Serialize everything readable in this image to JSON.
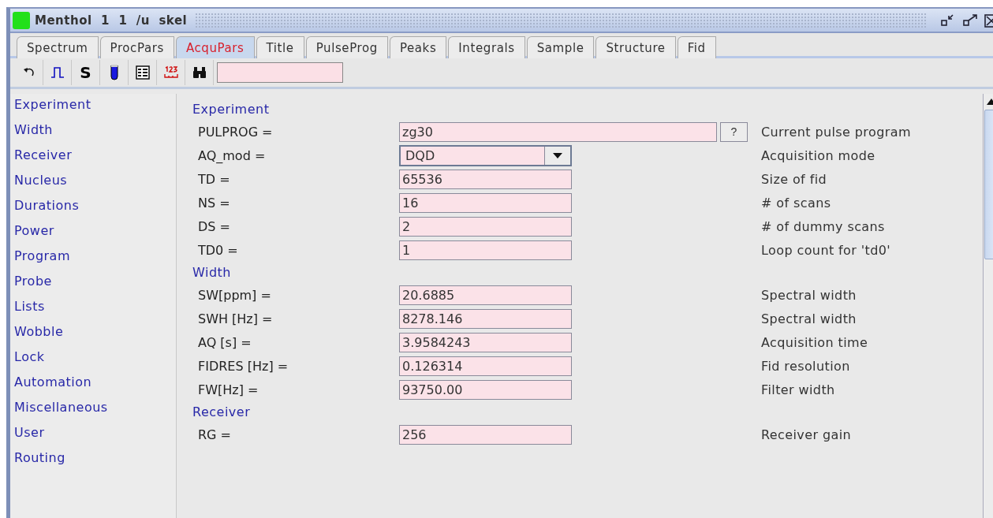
{
  "window": {
    "title": "Menthol  1  1  /u  skel"
  },
  "tabs": [
    {
      "label": "Spectrum",
      "selected": false
    },
    {
      "label": "ProcPars",
      "selected": false
    },
    {
      "label": "AcquPars",
      "selected": true
    },
    {
      "label": "Title",
      "selected": false
    },
    {
      "label": "PulseProg",
      "selected": false
    },
    {
      "label": "Peaks",
      "selected": false
    },
    {
      "label": "Integrals",
      "selected": false
    },
    {
      "label": "Sample",
      "selected": false
    },
    {
      "label": "Structure",
      "selected": false
    },
    {
      "label": "Fid",
      "selected": false
    }
  ],
  "toolbar": {
    "s_label": "S"
  },
  "sidebar": {
    "items": [
      "Experiment",
      "Width",
      "Receiver",
      "Nucleus",
      "Durations",
      "Power",
      "Program",
      "Probe",
      "Lists",
      "Wobble",
      "Lock",
      "Automation",
      "Miscellaneous",
      "User",
      "Routing"
    ]
  },
  "sections": [
    {
      "heading": "Experiment",
      "params": [
        {
          "kind": "program",
          "label": "PULPROG =",
          "value": "zg30",
          "button": "?",
          "description": "Current pulse program"
        },
        {
          "kind": "select",
          "label": "AQ_mod =",
          "value": "DQD",
          "description": "Acquisition mode"
        },
        {
          "kind": "text",
          "label": "TD =",
          "value": "65536",
          "description": "Size of fid"
        },
        {
          "kind": "text",
          "label": "NS =",
          "value": "16",
          "description": "# of scans"
        },
        {
          "kind": "text",
          "label": "DS =",
          "value": "2",
          "description": "# of dummy scans"
        },
        {
          "kind": "text",
          "label": "TD0 =",
          "value": "1",
          "description": "Loop count for 'td0'"
        }
      ]
    },
    {
      "heading": "Width",
      "params": [
        {
          "kind": "text",
          "label": "SW[ppm] =",
          "value": "20.6885",
          "description": "Spectral width"
        },
        {
          "kind": "text",
          "label": "SWH [Hz] =",
          "value": "8278.146",
          "description": "Spectral width"
        },
        {
          "kind": "text",
          "label": "AQ [s] =",
          "value": "3.9584243",
          "description": "Acquisition time"
        },
        {
          "kind": "text",
          "label": "FIDRES [Hz] =",
          "value": "0.126314",
          "description": "Fid resolution"
        },
        {
          "kind": "text",
          "label": "FW[Hz] =",
          "value": "93750.00",
          "description": "Filter width"
        }
      ]
    },
    {
      "heading": "Receiver",
      "params": [
        {
          "kind": "text",
          "label": "RG =",
          "value": "256",
          "description": "Receiver gain"
        }
      ]
    }
  ]
}
